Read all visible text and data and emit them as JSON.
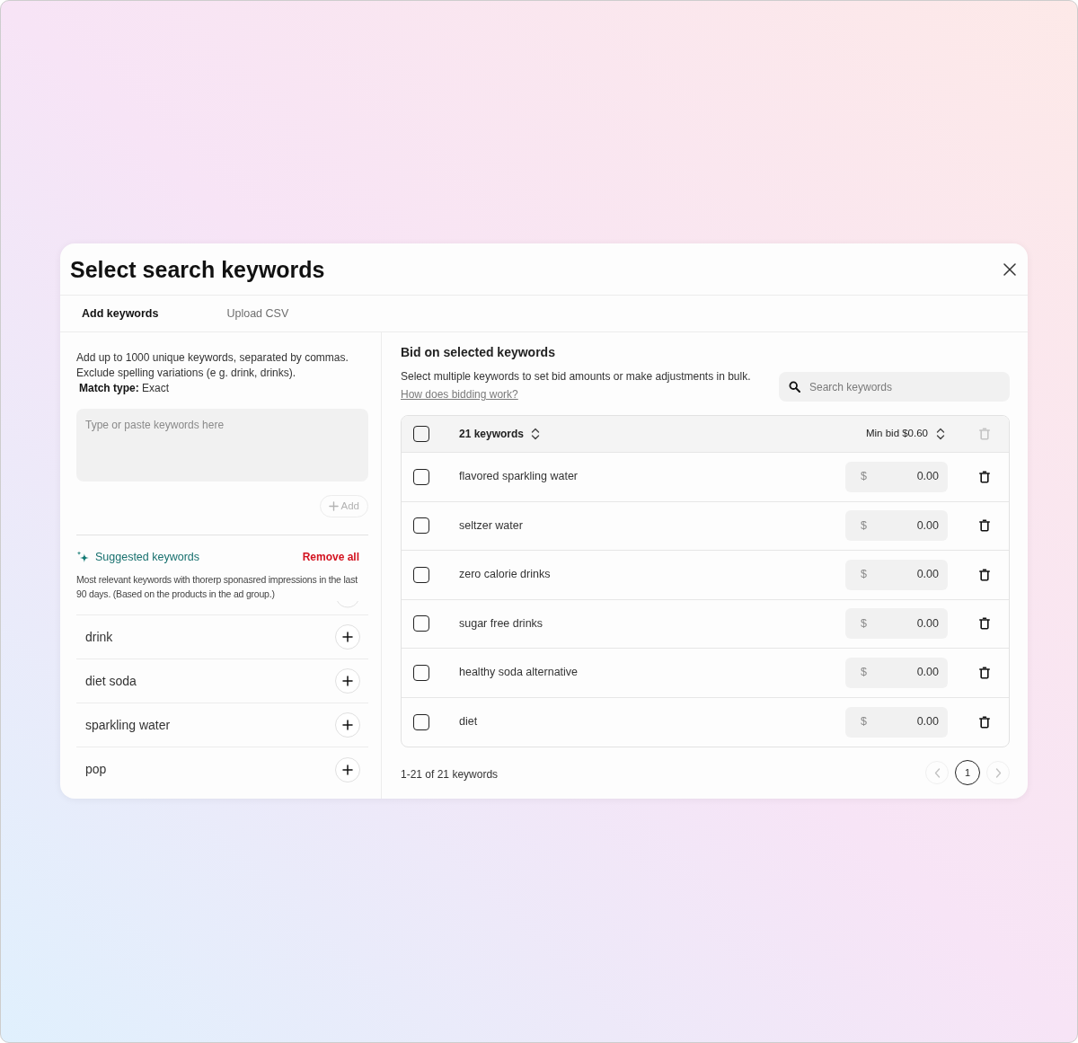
{
  "dialog": {
    "title": "Select search keywords"
  },
  "tabs": [
    {
      "label": "Add keywords",
      "selected": true
    },
    {
      "label": "Upload CSV",
      "selected": false
    }
  ],
  "add_panel": {
    "instructions": [
      "Add up to 1000 unique keywords, separated by commas.",
      "Exclude spelling variations (e g. drink, drinks)."
    ],
    "match_type": "**Match type:** Exact",
    "keywords_field": {
      "placeholder": "Type or paste keywords here"
    },
    "add_button": {
      "label": "Add",
      "disabled": true
    }
  },
  "suggestions": {
    "title": "Suggested keywords",
    "remove_all": "Remove all",
    "description": "Most relevant keywords with thorerp sponasred impressions in the last 90 days. (Based on the products in the ad group.)",
    "items": [
      {
        "label": "drink"
      },
      {
        "label": "diet soda"
      },
      {
        "label": "sparkling water"
      },
      {
        "label": "pop"
      }
    ]
  },
  "bid_panel": {
    "title": "Bid on selected keywords",
    "description": "Select multiple keywords to set bid amounts or make adjustments in bulk.",
    "help_link": "How does bidding work?",
    "search": {
      "placeholder": "Search keywords"
    },
    "table": {
      "header": {
        "checked": false,
        "keyword_count": "21 keywords",
        "min_bid": "Min bid $0.60",
        "delete_disabled": true
      },
      "rows": [
        {
          "keyword": "flavored sparkling water",
          "checked": false,
          "currency": "$",
          "bid": "0.00"
        },
        {
          "keyword": "seltzer water",
          "checked": false,
          "currency": "$",
          "bid": "0.00"
        },
        {
          "keyword": "zero calorie drinks",
          "checked": false,
          "currency": "$",
          "bid": "0.00"
        },
        {
          "keyword": "sugar free drinks",
          "checked": false,
          "currency": "$",
          "bid": "0.00"
        },
        {
          "keyword": "healthy soda alternative",
          "checked": false,
          "currency": "$",
          "bid": "0.00"
        },
        {
          "keyword": "diet",
          "checked": false,
          "currency": "$",
          "bid": "0.00"
        }
      ]
    },
    "footer": {
      "range": "1-21 of 21 keywords",
      "prev_disabled": true,
      "pages": [
        {
          "label": "1",
          "selected": true
        }
      ],
      "next_disabled": true
    }
  }
}
